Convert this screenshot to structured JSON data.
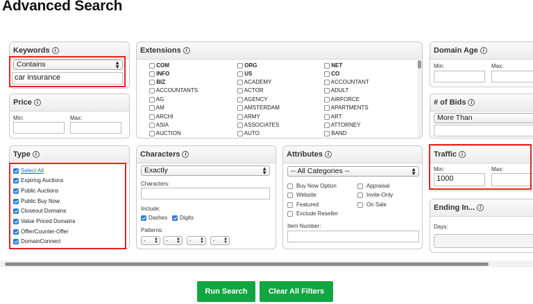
{
  "page": {
    "title": "Advanced Search"
  },
  "keywords": {
    "title": "Keywords",
    "match": "Contains",
    "value": "car insurance"
  },
  "price": {
    "title": "Price",
    "min_label": "Min:",
    "max_label": "Max:"
  },
  "extensions": {
    "title": "Extensions",
    "col1": [
      "COM",
      "INFO",
      "BIZ",
      "ACCOUNTANTS",
      "AG",
      "AM",
      "ARCHI",
      "ASIA",
      "AUCTION"
    ],
    "col2": [
      "ORG",
      "US",
      "ACADEMY",
      "ACTOR",
      "AGENCY",
      "AMSTERDAM",
      "ARMY",
      "ASSOCIATES",
      "AUTO"
    ],
    "col3": [
      "NET",
      "CO",
      "ACCOUNTANT",
      "ADULT",
      "AIRFORCE",
      "APARTMENTS",
      "ART",
      "ATTORNEY",
      "BAND"
    ]
  },
  "domain_age": {
    "title": "Domain Age",
    "min_label": "Min:",
    "max_label": "Max:"
  },
  "bids": {
    "title": "# of Bids",
    "value": "More Than"
  },
  "type": {
    "title": "Type",
    "items": [
      "Select All",
      "Expiring Auctions",
      "Public Auctions",
      "Public Buy Now",
      "Closeout Domains",
      "Value Priced Domains",
      "Offer/Counter-Offer",
      "DomainConnect"
    ]
  },
  "characters": {
    "title": "Characters",
    "mode": "Exactly",
    "characters_label": "Characters:",
    "include_label": "Include:",
    "dashes": "Dashes",
    "digits": "Digits",
    "patterns_label": "Patterns:",
    "pattern_value": "-"
  },
  "attributes": {
    "title": "Attributes",
    "category": "-- All Categories --",
    "left": [
      "Buy Now Option",
      "Website",
      "Featured",
      "Exclude Reseller"
    ],
    "right": [
      "Appraisal",
      "Invite-Only",
      "On Sale"
    ],
    "item_number_label": "Item Number:"
  },
  "traffic": {
    "title": "Traffic",
    "min_label": "Min:",
    "max_label": "Max:",
    "min_value": "1000"
  },
  "ending": {
    "title": "Ending In...",
    "days_label": "Days:"
  },
  "buttons": {
    "run": "Run Search",
    "clear": "Clear All Filters"
  },
  "colors": {
    "accent_green": "#11a63f",
    "highlight_red": "#e8231a",
    "checkbox_blue": "#2a7fd6"
  }
}
